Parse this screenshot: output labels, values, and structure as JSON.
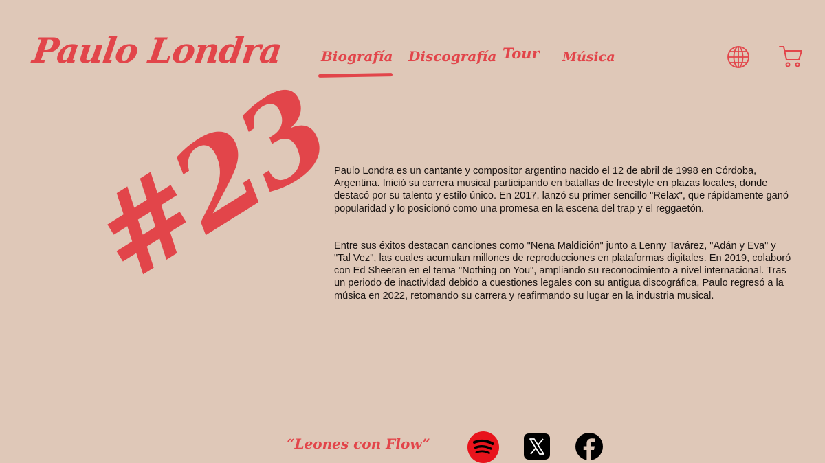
{
  "brand": {
    "name": "Paulo Londra"
  },
  "nav": {
    "items": [
      {
        "label": "Biografía",
        "active": true
      },
      {
        "label": "Discografía"
      },
      {
        "label": "Tour"
      },
      {
        "label": "Música"
      }
    ]
  },
  "header_icons": {
    "language": "globe-icon",
    "cart": "cart-icon"
  },
  "hero": {
    "number": "#23"
  },
  "biography": {
    "paragraphs": [
      "Paulo Londra es un cantante y compositor argentino nacido el 12 de abril de 1998 en Córdoba, Argentina. Inició su carrera musical participando en batallas de freestyle en plazas locales, donde destacó por su talento y estilo único. En 2017, lanzó su primer sencillo \"Relax\", que rápidamente ganó popularidad y lo posicionó como una promesa en la escena del trap y el reggaetón.",
      "Entre sus éxitos destacan canciones como \"Nena Maldición\" junto a Lenny Tavárez, \"Adán y Eva\" y \"Tal Vez\", las cuales acumulan millones de reproducciones en plataformas digitales. En 2019, colaboró con Ed Sheeran en el tema \"Nothing on You\", ampliando su reconocimiento a nivel internacional. Tras un periodo de inactividad debido a cuestiones legales con su antigua discográfica, Paulo regresó a la música en 2022, retomando su carrera y reafirmando su lugar en la industria musical."
    ]
  },
  "footer": {
    "slogan": "“Leones con Flow”",
    "social": [
      "spotify-icon",
      "x-icon",
      "facebook-icon"
    ]
  },
  "colors": {
    "accent": "#e2454a",
    "background": "#dfc8b8",
    "text": "#1a1412"
  }
}
